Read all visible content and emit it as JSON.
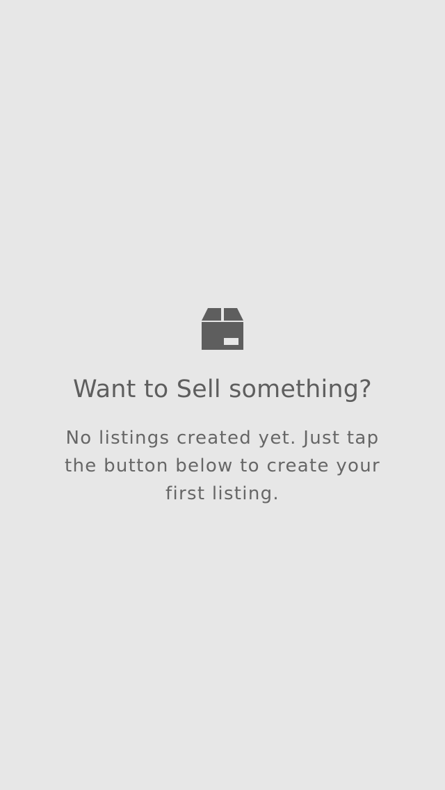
{
  "empty_state": {
    "icon": "package-box-icon",
    "title": "Want to Sell something?",
    "message": "No listings created yet. Just tap the button below to create your first listing."
  },
  "colors": {
    "background": "#e7e7e7",
    "icon": "#5e5e5e",
    "title_text": "#5e5e5e",
    "message_text": "#666666"
  }
}
